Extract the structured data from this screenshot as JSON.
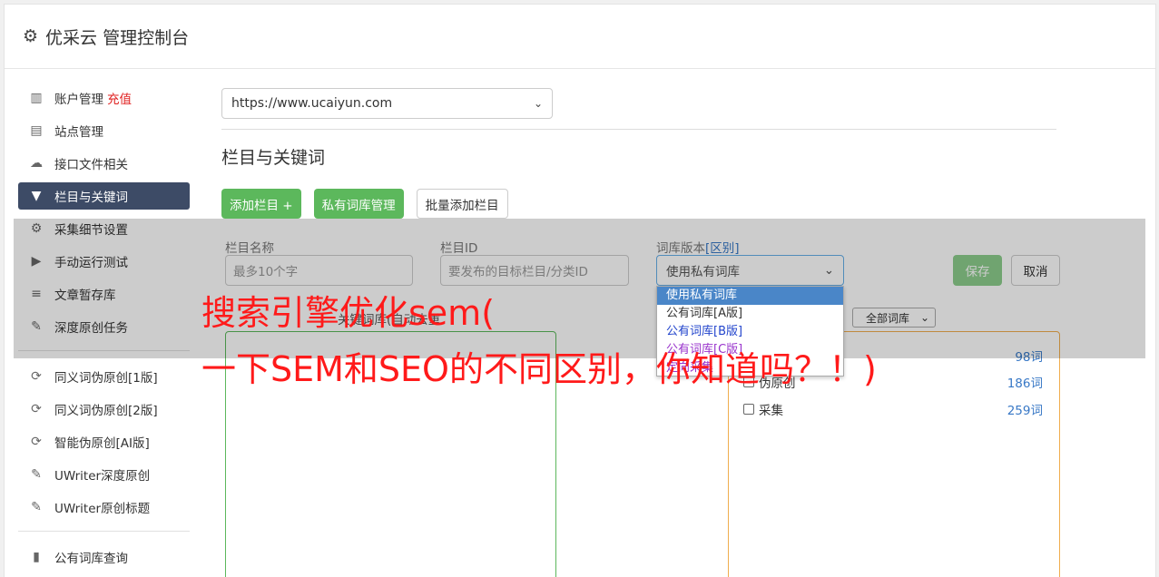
{
  "header": {
    "title": "优采云 管理控制台",
    "icon": "gear-icon"
  },
  "sidebar": {
    "items": [
      {
        "label": "账户管理",
        "badge": "充值",
        "icon": "bar-chart-icon"
      },
      {
        "label": "站点管理",
        "icon": "server-icon"
      },
      {
        "label": "接口文件相关",
        "icon": "cloud-upload-icon"
      },
      {
        "label": "栏目与关键词",
        "icon": "filter-icon",
        "active": true
      },
      {
        "label": "采集细节设置",
        "icon": "cogs-icon"
      },
      {
        "label": "手动运行测试",
        "icon": "play-icon"
      },
      {
        "label": "文章暂存库",
        "icon": "database-icon"
      },
      {
        "label": "深度原创任务",
        "icon": "edit-icon"
      }
    ],
    "items2": [
      {
        "label": "同义词伪原创[1版]",
        "icon": "refresh-icon"
      },
      {
        "label": "同义词伪原创[2版]",
        "icon": "refresh-icon"
      },
      {
        "label": "智能伪原创[AI版]",
        "icon": "refresh-icon"
      },
      {
        "label": "UWriter深度原创",
        "icon": "edit-icon"
      },
      {
        "label": "UWriter原创标题",
        "icon": "edit-icon"
      }
    ],
    "items3": [
      {
        "label": "公有词库查询",
        "icon": "book-icon"
      }
    ]
  },
  "main": {
    "site_select": "https://www.ucaiyun.com",
    "section_title": "栏目与关键词",
    "buttons": {
      "add_column": "添加栏目 +",
      "private_lib": "私有词库管理",
      "batch_add": "批量添加栏目"
    }
  },
  "form": {
    "column_name_label": "栏目名称",
    "column_name_placeholder": "最多10个字",
    "column_id_label": "栏目ID",
    "column_id_placeholder": "要发布的目标栏目/分类ID",
    "lib_version_label": "词库版本",
    "lib_version_link": "[区别]",
    "lib_version_value": "使用私有词库",
    "dropdown_options": [
      "使用私有词库",
      "公有词库[A版]",
      "公有词库[B版]",
      "公有词库[C版]",
      "定向采集"
    ],
    "save": "保存",
    "cancel": "取消",
    "lib_filter_label": "关键词库(自动去重",
    "lib_filter_value": "全部词库"
  },
  "libraries": [
    {
      "name": "",
      "count": "98词"
    },
    {
      "name": "伪原创",
      "count": "186词"
    },
    {
      "name": "采集",
      "count": "259词"
    }
  ],
  "watermark": {
    "line1": "搜索引擎优化sem(",
    "line2": "一下SEM和SEO的不同区别，你知道吗？！)"
  },
  "colors": {
    "accent": "#3d4b66",
    "green": "#5cb85c",
    "watermark": "#ff1a1a"
  }
}
